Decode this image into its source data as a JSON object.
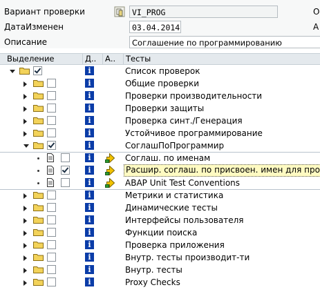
{
  "header": {
    "variant_label": "Вариант проверки",
    "variant_value": "VI_PROG",
    "changed_label": "ДатаИзменен",
    "changed_value": "03.04.2014",
    "desc_label": "Описание",
    "desc_value": "Соглашение по программированию",
    "right_edge_1": "О",
    "right_edge_2": "А"
  },
  "columns": {
    "selection": "Выделение",
    "d": "Д..",
    "a": "А..",
    "tests": "Тесты"
  },
  "rows": [
    {
      "text": "Список проверок",
      "kind": "folder",
      "toggle": "expanded",
      "checked": true
    },
    {
      "text": "Общие проверки",
      "kind": "folder",
      "toggle": "collapsed",
      "checked": false
    },
    {
      "text": "Проверки производительности",
      "kind": "folder",
      "toggle": "collapsed",
      "checked": false
    },
    {
      "text": "Проверки защиты",
      "kind": "folder",
      "toggle": "collapsed",
      "checked": false
    },
    {
      "text": "Проверка синт./Генерация",
      "kind": "folder",
      "toggle": "collapsed",
      "checked": false
    },
    {
      "text": "Устойчивое программирование",
      "kind": "folder",
      "toggle": "collapsed",
      "checked": false
    },
    {
      "text": "СоглашПоПрограммир",
      "kind": "folder",
      "toggle": "expanded",
      "checked": true
    },
    {
      "text": "Соглаш. по именам",
      "kind": "doc",
      "toggle": "bullet",
      "checked": false,
      "arrow": true
    },
    {
      "text": "Расшир. соглаш. по присвоен. имен для прог.",
      "kind": "doc",
      "toggle": "bullet",
      "checked": true,
      "arrow": true,
      "highlight": true
    },
    {
      "text": "ABAP Unit Test Conventions",
      "kind": "doc",
      "toggle": "bullet",
      "checked": false,
      "arrow": true
    },
    {
      "text": "Метрики и статистика",
      "kind": "folder",
      "toggle": "collapsed",
      "checked": false
    },
    {
      "text": "Динамические тесты",
      "kind": "folder",
      "toggle": "collapsed",
      "checked": false
    },
    {
      "text": "Интерфейсы пользователя",
      "kind": "folder",
      "toggle": "collapsed",
      "checked": false
    },
    {
      "text": "Функции поиска",
      "kind": "folder",
      "toggle": "collapsed",
      "checked": false
    },
    {
      "text": "Проверка приложения",
      "kind": "folder",
      "toggle": "collapsed",
      "checked": false
    },
    {
      "text": "Внутр. тесты производит-ти",
      "kind": "folder",
      "toggle": "collapsed",
      "checked": false
    },
    {
      "text": "Внутр. тесты",
      "kind": "folder",
      "toggle": "collapsed",
      "checked": false
    },
    {
      "text": "Proxy Checks",
      "kind": "folder",
      "toggle": "collapsed",
      "checked": false
    }
  ],
  "colors": {
    "info_blue": "#0a3ca8",
    "folder_yellow": "#f3d35a",
    "highlight_bg": "#fffbc2"
  }
}
